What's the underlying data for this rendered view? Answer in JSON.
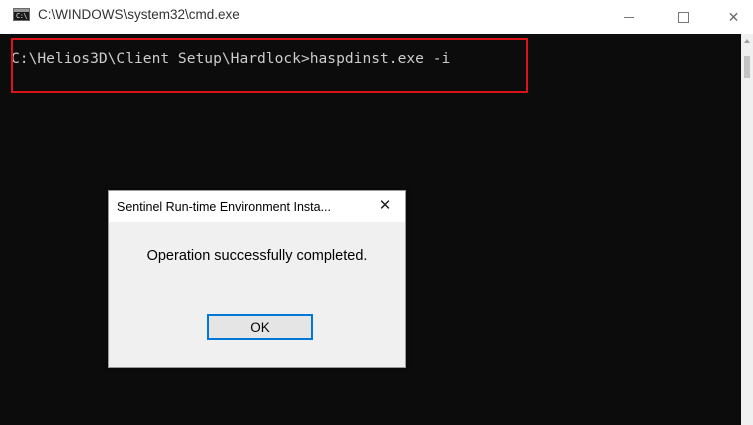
{
  "window": {
    "title": "C:\\WINDOWS\\system32\\cmd.exe",
    "icon_text": "C:\\",
    "minimize_glyph": "—",
    "maximize_glyph": "☐",
    "close_glyph": "✕"
  },
  "console": {
    "command_line": "C:\\Helios3D\\Client Setup\\Hardlock>haspdinst.exe -i",
    "highlight_color": "#d9141b"
  },
  "dialog": {
    "title": "Sentinel Run-time Environment Insta...",
    "close_glyph": "✕",
    "message": "Operation successfully completed.",
    "ok_label": "OK"
  },
  "colors": {
    "console_bg": "#0c0c0c",
    "console_text": "#cccccc",
    "accent": "#0078d7"
  }
}
